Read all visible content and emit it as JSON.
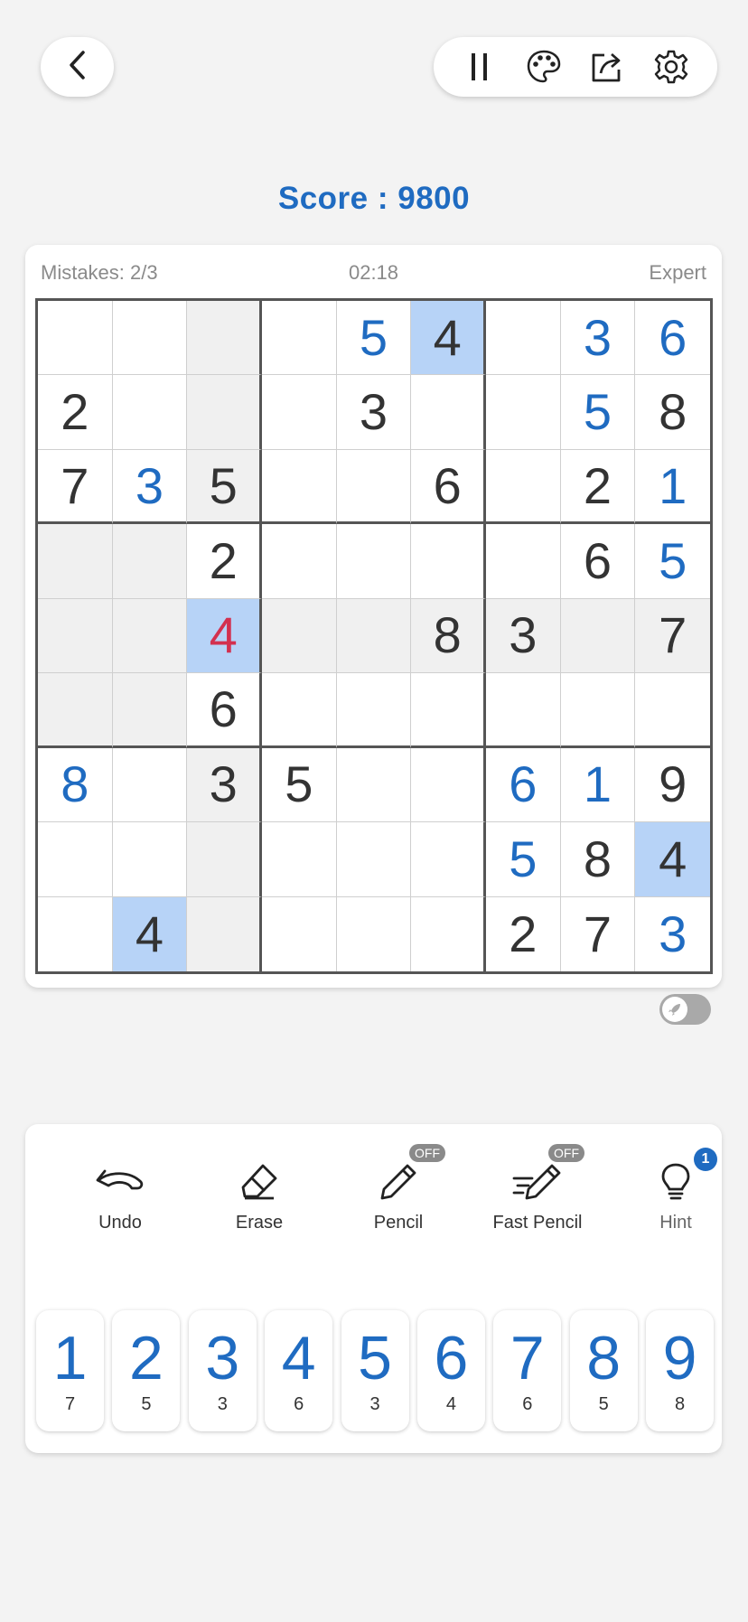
{
  "header": {
    "back_icon": "chevron-left-icon",
    "tools": [
      "pause-icon",
      "palette-icon",
      "share-icon",
      "gear-icon"
    ]
  },
  "score": {
    "label": "Score : ",
    "value": "9800"
  },
  "status": {
    "mistakes": "Mistakes: 2/3",
    "timer": "02:18",
    "level": "Expert"
  },
  "board": {
    "rows": [
      [
        "",
        "",
        "",
        "",
        "5",
        "4",
        "",
        "3",
        "6"
      ],
      [
        "2",
        "",
        "",
        "",
        "3",
        "",
        "",
        "5",
        "8"
      ],
      [
        "7",
        "3",
        "5",
        "",
        "",
        "6",
        "",
        "2",
        "1"
      ],
      [
        "",
        "",
        "2",
        "",
        "",
        "",
        "",
        "6",
        "5"
      ],
      [
        "",
        "",
        "4",
        "",
        "",
        "8",
        "3",
        "",
        "7"
      ],
      [
        "",
        "",
        "6",
        "",
        "",
        "",
        "",
        "",
        ""
      ],
      [
        "8",
        "",
        "3",
        "5",
        "",
        "",
        "6",
        "1",
        "9"
      ],
      [
        "",
        "",
        "",
        "",
        "",
        "",
        "5",
        "8",
        "4"
      ],
      [
        "",
        "4",
        "",
        "",
        "",
        "",
        "2",
        "7",
        "3"
      ]
    ],
    "user_cells": [
      "0-4",
      "0-7",
      "0-8",
      "1-7",
      "2-1",
      "2-8",
      "3-8",
      "6-0",
      "6-6",
      "6-7",
      "7-6",
      "8-8"
    ],
    "error_cells": [
      "4-2"
    ],
    "selected_cells": [
      "0-5",
      "4-2",
      "7-8",
      "8-1"
    ],
    "highlight_cells": [
      "0-2",
      "1-2",
      "2-2",
      "3-0",
      "3-1",
      "4-0",
      "4-1",
      "4-3",
      "4-4",
      "4-5",
      "4-6",
      "4-7",
      "4-8",
      "5-0",
      "5-1",
      "6-2",
      "7-2",
      "8-2"
    ],
    "colors": {
      "user": "#1f6bc1",
      "error": "#d3304f",
      "selected": "#b7d3f7",
      "highlight": "#f0f0f0"
    }
  },
  "actions": [
    {
      "label": "Undo",
      "icon": "undo-icon"
    },
    {
      "label": "Erase",
      "icon": "eraser-icon"
    },
    {
      "label": "Pencil",
      "icon": "pencil-icon",
      "badge": "OFF"
    },
    {
      "label": "Fast Pencil",
      "icon": "fast-pencil-icon",
      "badge": "OFF"
    },
    {
      "label": "Hint",
      "icon": "lightbulb-icon",
      "badge": "1"
    }
  ],
  "numpad": [
    {
      "n": "1",
      "count": "7"
    },
    {
      "n": "2",
      "count": "5"
    },
    {
      "n": "3",
      "count": "3"
    },
    {
      "n": "4",
      "count": "6"
    },
    {
      "n": "5",
      "count": "3"
    },
    {
      "n": "6",
      "count": "4"
    },
    {
      "n": "7",
      "count": "6"
    },
    {
      "n": "8",
      "count": "5"
    },
    {
      "n": "9",
      "count": "8"
    }
  ]
}
